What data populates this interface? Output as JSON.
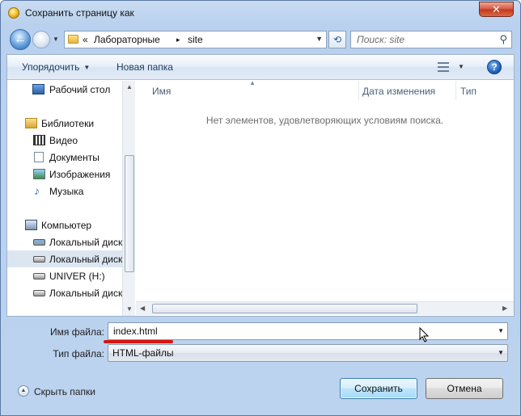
{
  "window": {
    "title": "Сохранить страницу как",
    "close_glyph": "✕"
  },
  "address_bar": {
    "prefix": "«",
    "crumbs": [
      "Лабораторные",
      "site"
    ],
    "separator": "▸",
    "search_placeholder": "Поиск: site"
  },
  "toolbar": {
    "organize_label": "Упорядочить",
    "new_folder_label": "Новая папка",
    "help_label": "?"
  },
  "navigation": {
    "items": [
      {
        "label": "Рабочий стол",
        "icon": "desktop-icon"
      },
      {
        "label": "Библиотеки",
        "icon": "libraries-icon"
      },
      {
        "label": "Видео",
        "icon": "video-icon"
      },
      {
        "label": "Документы",
        "icon": "documents-icon"
      },
      {
        "label": "Изображения",
        "icon": "pictures-icon"
      },
      {
        "label": "Музыка",
        "icon": "music-icon"
      },
      {
        "label": "Компьютер",
        "icon": "computer-icon"
      },
      {
        "label": "Локальный диск",
        "icon": "system-disk-icon"
      },
      {
        "label": "Локальный диск",
        "icon": "disk-icon",
        "selected": true
      },
      {
        "label": "UNIVER (H:)",
        "icon": "usb-drive-icon"
      },
      {
        "label": "Локальный диск",
        "icon": "disk-icon"
      }
    ]
  },
  "content": {
    "columns": [
      "Имя",
      "Дата изменения",
      "Тип"
    ],
    "empty_message": "Нет элементов, удовлетворяющих условиям поиска."
  },
  "form": {
    "filename_label": "Имя файла:",
    "filename_value": "index.html",
    "filetype_label": "Тип файла:",
    "filetype_value": "HTML-файлы"
  },
  "footer": {
    "hide_folders_label": "Скрыть папки",
    "save_label": "Сохранить",
    "cancel_label": "Отмена"
  },
  "colors": {
    "title_bar": "#bcd3ef",
    "close_button": "#c9402a",
    "annotation_underline": "#d8150e",
    "primary_button": "#bee6fd"
  }
}
